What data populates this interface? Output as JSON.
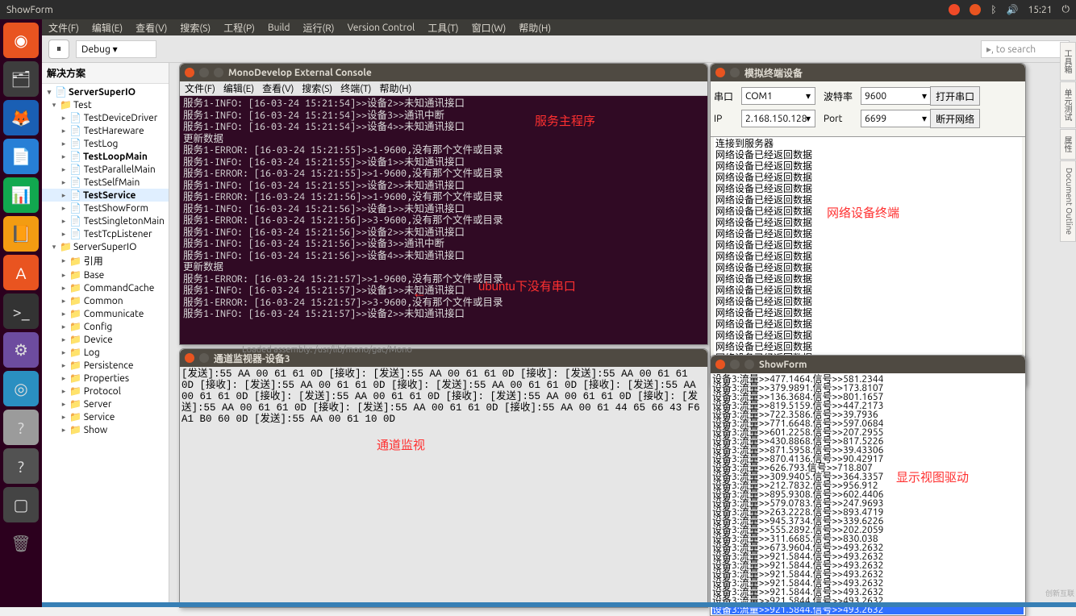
{
  "topbar": {
    "title": "ShowForm",
    "time": "15:21",
    "icons": [
      "network",
      "en",
      "bluetooth",
      "sound"
    ]
  },
  "menubar": [
    "文件(F)",
    "编辑(E)",
    "查看(V)",
    "搜索(S)",
    "工程(P)",
    "Build",
    "运行(R)",
    "Version Control",
    "工具(T)",
    "窗口(W)",
    "帮助(H)"
  ],
  "toolbar": {
    "debug": "Debug",
    "search_ph": ", to search"
  },
  "solution": {
    "title": "解决方案",
    "root": "ServerSuperIO",
    "test": "Test",
    "test_items": [
      "TestDeviceDriver",
      "TestHareware",
      "TestLog",
      "TestLoopMain",
      "TestParallelMain",
      "TestSelfMain",
      "TestService",
      "TestShowForm",
      "TestSingletonMain",
      "TestTcpListener"
    ],
    "lib": "ServerSuperIO",
    "lib_items": [
      "引用",
      "Base",
      "CommandCache",
      "Common",
      "Communicate",
      "Config",
      "Device",
      "Log",
      "Persistence",
      "Properties",
      "Protocol",
      "Server",
      "Service",
      "Show"
    ]
  },
  "console": {
    "title": "MonoDevelop External Console",
    "menu": [
      "文件(F)",
      "编辑(E)",
      "查看(V)",
      "搜索(S)",
      "终端(T)",
      "帮助(H)"
    ],
    "label_main": "服务主程序",
    "label_port": "ubuntu下没有串口",
    "lines": [
      "服务1-INFO: [16-03-24 15:21:54]>>设备2>>未知通讯接口",
      "服务1-INFO: [16-03-24 15:21:54]>>设备3>>通讯中断",
      "服务1-INFO: [16-03-24 15:21:54]>>设备4>>未知通讯接口",
      "更新数据",
      "服务1-ERROR: [16-03-24 15:21:55]>>1-9600,没有那个文件或目录",
      "服务1-INFO: [16-03-24 15:21:55]>>设备1>>未知通讯接口",
      "服务1-ERROR: [16-03-24 15:21:55]>>1-9600,没有那个文件或目录",
      "服务1-INFO: [16-03-24 15:21:55]>>设备2>>未知通讯接口",
      "服务1-ERROR: [16-03-24 15:21:56]>>1-9600,没有那个文件或目录",
      "服务1-INFO: [16-03-24 15:21:56]>>设备1>>未知通讯接口",
      "服务1-ERROR: [16-03-24 15:21:56]>>3-9600,没有那个文件或目录",
      "服务1-INFO: [16-03-24 15:21:56]>>设备2>>未知通讯接口",
      "服务1-INFO: [16-03-24 15:21:56]>>设备3>>通讯中断",
      "服务1-INFO: [16-03-24 15:21:56]>>设备4>>未知通讯接口",
      "更新数据",
      "服务1-ERROR: [16-03-24 15:21:57]>>1-9600,没有那个文件或目录",
      "服务1-INFO: [16-03-24 15:21:57]>>设备1>>未知通讯接口",
      "服务1-ERROR: [16-03-24 15:21:57]>>3-9600,没有那个文件或目录",
      "服务1-INFO: [16-03-24 15:21:57]>>设备2>>未知通讯接口"
    ],
    "loaded": "Loaded assembly: /usr/lib/mono/gac/Mono"
  },
  "device": {
    "title": "模拟终端设备",
    "label_annot": "网络设备终端",
    "serial_lbl": "串口",
    "serial_val": "COM1",
    "baud_lbl": "波特率",
    "baud_val": "9600",
    "open_btn": "打开串口",
    "ip_lbl": "IP",
    "ip_val": "2.168.150.128",
    "port_lbl": "Port",
    "port_val": "6699",
    "net_btn": "断开网络",
    "first": "连接到服务器",
    "repeat": "网络设备已经返回数据"
  },
  "channel": {
    "title": "通道监视器-设备3",
    "label": "通道监视",
    "send": "[发送]:55 AA 00 61 61 0D",
    "recv": "[接收]:",
    "recv_long": "[接收]:55 AA 00 61 44 65 66 43 F6 A1 B0 60 0D",
    "send_last": "[发送]:55 AA 00 61 10 0D"
  },
  "showform": {
    "title": "ShowForm",
    "label": "显示视图驱动",
    "lines": [
      "设备3:流量>>477.1464.信号>>581.2344",
      "设备3:流量>>379.9891.信号>>173.8107",
      "设备3:流量>>136.3684.信号>>801.1657",
      "设备3:流量>>819.5159.信号>>447.2173",
      "设备3:流量>>722.3586.信号>>39.7936",
      "设备3:流量>>771.6648.信号>>597.0684",
      "设备3:流量>>601.2258.信号>>207.2955",
      "设备3:流量>>430.8868.信号>>817.5226",
      "设备3:流量>>871.5958.信号>>39.43306",
      "设备3:流量>>870.4136.信号>>90.42917",
      "设备3:流量>>626.793.信号>>718.807",
      "设备3:流量>>309.9405.信号>>364.3357",
      "设备3:流量>>212.7832.信号>>956.912",
      "设备3:流量>>895.9308.信号>>602.4406",
      "设备3:流量>>579.0783.信号>>247.9693",
      "设备3:流量>>263.2228.信号>>893.4719",
      "设备3:流量>>945.3734.信号>>339.6226",
      "设备3:流量>>555.2892.信号>>202.2059",
      "设备3:流量>>311.6685.信号>>830.038",
      "设备3:流量>>673.9604.信号>>493.2632",
      "设备3:流量>>921.5844.信号>>493.2632",
      "设备3:流量>>921.5844.信号>>493.2632",
      "设备3:流量>>921.5844.信号>>493.2632",
      "设备3:流量>>921.5844.信号>>493.2632",
      "设备3:流量>>921.5844.信号>>493.2632",
      "设备3:流量>>921.5844.信号>>493.2632",
      "设备3:流量>>921.5844.信号>>493.2632"
    ]
  },
  "side_tabs": [
    "工具箱",
    "单元测试",
    "属性",
    "Document Outline"
  ],
  "corner": "创新互联"
}
